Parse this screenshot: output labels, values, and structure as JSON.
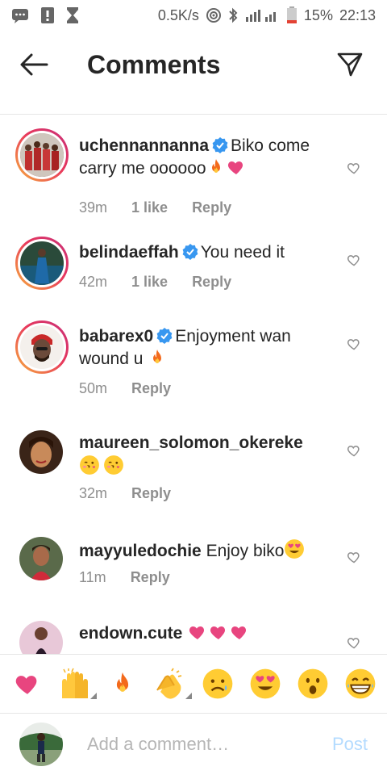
{
  "status_bar": {
    "speed": "0.5K/s",
    "battery": "15%",
    "time": "22:13",
    "icons": [
      "message-icon",
      "alert-icon",
      "hourglass-icon",
      "hotspot-icon",
      "bluetooth-icon",
      "signal-icon",
      "battery-icon"
    ]
  },
  "header": {
    "title": "Comments",
    "back_icon": "arrow-left-icon",
    "send_icon": "paper-plane-icon"
  },
  "comments": [
    {
      "username": "uchennannanna",
      "verified": true,
      "text": "Biko come carry me oooooo",
      "emojis": [
        "fire",
        "pink-heart"
      ],
      "time": "39m",
      "likes": "1 like",
      "reply": "Reply",
      "avatar_color": "#b43a3a"
    },
    {
      "username": "belindaeffah",
      "verified": true,
      "text": "You need it",
      "emojis": [],
      "time": "42m",
      "likes": "1 like",
      "reply": "Reply",
      "avatar_color": "#1f6a8a"
    },
    {
      "username": "babarex0",
      "verified": true,
      "text": "Enjoyment wan wound u",
      "emojis": [
        "fire"
      ],
      "time": "50m",
      "likes": "",
      "reply": "Reply",
      "avatar_color": "#6b4a3a"
    },
    {
      "username": "maureen_solomon_okereke",
      "verified": false,
      "text": "",
      "emojis": [
        "kissing-face",
        "kissing-face"
      ],
      "time": "32m",
      "likes": "",
      "reply": "Reply",
      "avatar_color": "#5a3a2a"
    },
    {
      "username": "mayyuledochie",
      "verified": false,
      "text": "Enjoy biko",
      "emojis": [
        "heart-eyes"
      ],
      "time": "11m",
      "likes": "",
      "reply": "Reply",
      "avatar_color": "#4a5a3a"
    },
    {
      "username": "endown.cute",
      "verified": false,
      "text": "",
      "emojis": [
        "pink-heart",
        "pink-heart",
        "pink-heart"
      ],
      "time": "",
      "likes": "",
      "reply": "",
      "avatar_color": "#8a4a6a"
    }
  ],
  "emoji_bar": [
    "pink-heart",
    "raising-hands",
    "fire",
    "clapping-hands",
    "sad-face",
    "heart-eyes",
    "surprised-face",
    "grinning-face"
  ],
  "input": {
    "placeholder": "Add a comment…",
    "post_label": "Post"
  },
  "colors": {
    "accent_blue": "#3897f0",
    "verified": "#3897f0",
    "muted": "#8e8e8e",
    "post_disabled": "#b3dbff",
    "pink_heart": "#e8457f"
  }
}
